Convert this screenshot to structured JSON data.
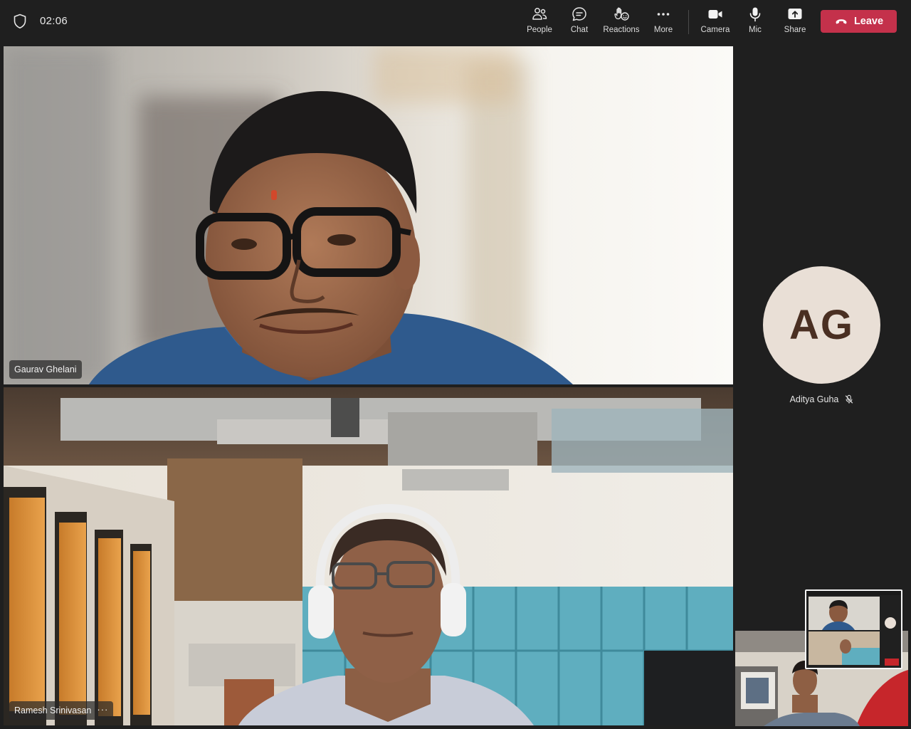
{
  "meeting": {
    "timer": "02:06"
  },
  "toolbar": {
    "people_label": "People",
    "chat_label": "Chat",
    "reactions_label": "Reactions",
    "more_label": "More",
    "camera_label": "Camera",
    "mic_label": "Mic",
    "share_label": "Share",
    "leave_label": "Leave"
  },
  "participants": {
    "main_1": {
      "name": "Gaurav Ghelani"
    },
    "main_2": {
      "name": "Ramesh Srinivasan",
      "more": "···"
    },
    "avatar": {
      "initials": "AG",
      "name": "Aditya Guha",
      "muted_icon": "mic-off-icon"
    }
  },
  "colors": {
    "background": "#1f1f1f",
    "leave_button": "#c4314b",
    "avatar_bg": "#e9dfd6",
    "avatar_text": "#4a2f22"
  }
}
